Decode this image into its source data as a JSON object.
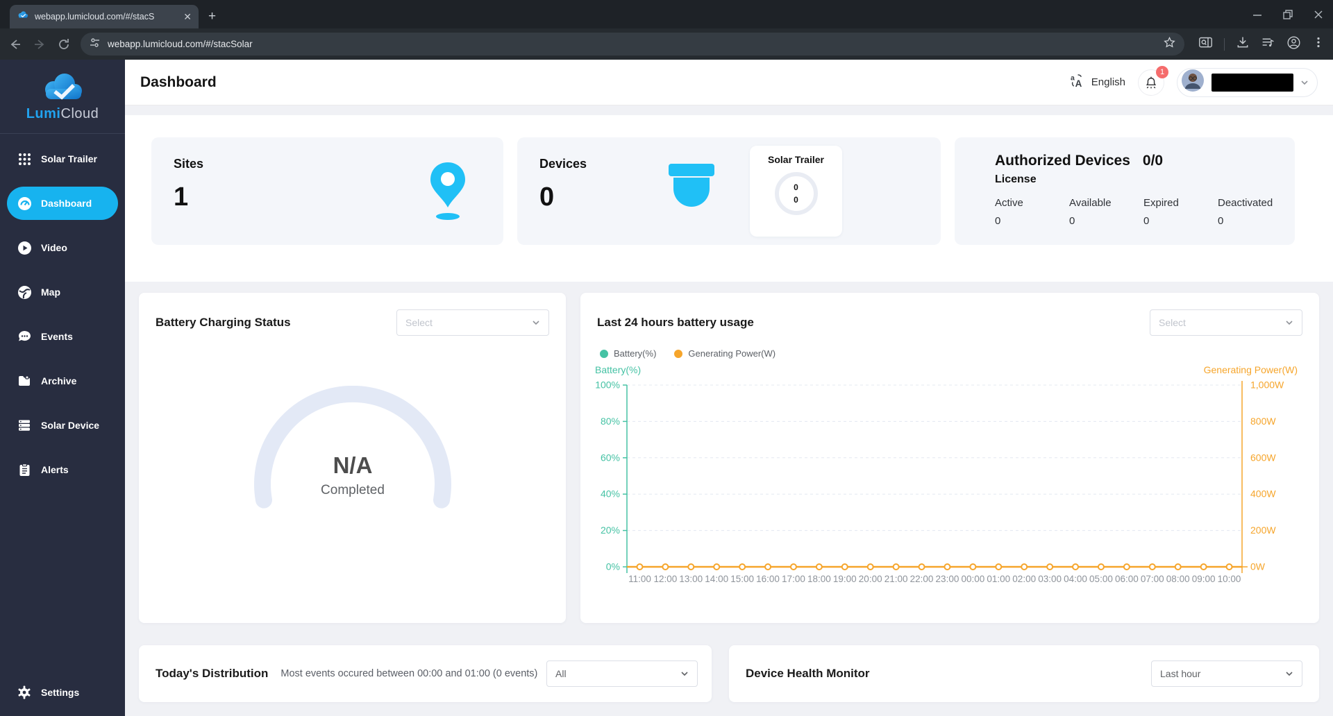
{
  "browser": {
    "tab_title": "webapp.lumicloud.com/#/stacS",
    "url": "webapp.lumicloud.com/#/stacSolar"
  },
  "sidebar": {
    "brand_bold": "Lumi",
    "brand_light": "Cloud",
    "items": [
      {
        "label": "Solar Trailer",
        "icon": "grid-icon",
        "active": false
      },
      {
        "label": "Dashboard",
        "icon": "dashboard-icon",
        "active": true
      },
      {
        "label": "Video",
        "icon": "video-icon",
        "active": false
      },
      {
        "label": "Map",
        "icon": "map-icon",
        "active": false
      },
      {
        "label": "Events",
        "icon": "events-icon",
        "active": false
      },
      {
        "label": "Archive",
        "icon": "archive-icon",
        "active": false
      },
      {
        "label": "Solar Device",
        "icon": "solar-device-icon",
        "active": false
      },
      {
        "label": "Alerts",
        "icon": "alerts-icon",
        "active": false
      }
    ],
    "settings_label": "Settings"
  },
  "header": {
    "title": "Dashboard",
    "language_label": "English",
    "notification_badge": "1"
  },
  "stats": {
    "sites": {
      "label": "Sites",
      "value": "1"
    },
    "devices": {
      "label": "Devices",
      "value": "0"
    },
    "solar_trailer": {
      "title": "Solar Trailer",
      "value_top": "0",
      "value_bottom": "0"
    },
    "authorized": {
      "title": "Authorized Devices",
      "ratio": "0/0",
      "subtitle": "License",
      "license_stats": [
        {
          "label": "Active",
          "value": "0"
        },
        {
          "label": "Available",
          "value": "0"
        },
        {
          "label": "Expired",
          "value": "0"
        },
        {
          "label": "Deactivated",
          "value": "0"
        }
      ]
    }
  },
  "battery_status": {
    "title": "Battery Charging Status",
    "select_placeholder": "Select",
    "gauge_value": "N/A",
    "gauge_caption": "Completed"
  },
  "battery_usage": {
    "title": "Last 24 hours battery usage",
    "select_placeholder": "Select"
  },
  "chart_data": {
    "type": "line",
    "title": "Last 24 hours battery usage",
    "x_labels": [
      "11:00",
      "12:00",
      "13:00",
      "14:00",
      "15:00",
      "16:00",
      "17:00",
      "18:00",
      "19:00",
      "20:00",
      "21:00",
      "22:00",
      "23:00",
      "00:00",
      "01:00",
      "02:00",
      "03:00",
      "04:00",
      "05:00",
      "06:00",
      "07:00",
      "08:00",
      "09:00",
      "10:00"
    ],
    "series": [
      {
        "name": "Battery(%)",
        "color": "#45c2a4",
        "axis": "left",
        "values": []
      },
      {
        "name": "Generating Power(W)",
        "color": "#f6a52b",
        "axis": "right",
        "values": [
          0,
          0,
          0,
          0,
          0,
          0,
          0,
          0,
          0,
          0,
          0,
          0,
          0,
          0,
          0,
          0,
          0,
          0,
          0,
          0,
          0,
          0,
          0,
          0
        ]
      }
    ],
    "left_axis": {
      "label": "Battery(%)",
      "min": 0,
      "max": 100,
      "color": "#45c2a4",
      "tick_labels": [
        "100%",
        "80%",
        "60%",
        "40%",
        "20%",
        "0%"
      ]
    },
    "right_axis": {
      "label": "Generating Power(W)",
      "min": 0,
      "max": 1000,
      "color": "#f6a52b",
      "tick_labels": [
        "1,000W",
        "800W",
        "600W",
        "400W",
        "200W",
        "0W"
      ]
    },
    "grid": "horizontal-dashed",
    "legend_position": "top-left",
    "note": "Battery(%) series shows no data points; Generating Power(W) is 0W for all 24 hours"
  },
  "distribution": {
    "title": "Today's Distribution",
    "subtitle": "Most events occured between 00:00 and 01:00 (0 events)",
    "select_value": "All"
  },
  "health": {
    "title": "Device Health Monitor",
    "select_value": "Last hour"
  }
}
